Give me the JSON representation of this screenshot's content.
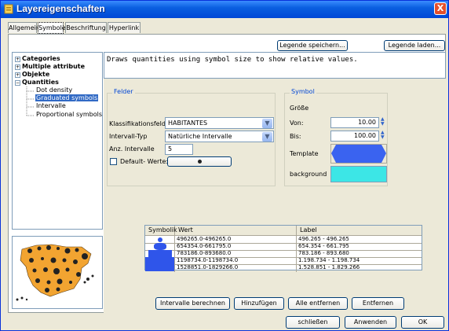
{
  "window": {
    "title": "Layereigenschaften",
    "close_glyph": "X"
  },
  "tabs": [
    {
      "label": "Allgemein"
    },
    {
      "label": "Symbole"
    },
    {
      "label": "Beschriftung"
    },
    {
      "label": "Hyperlink"
    }
  ],
  "legend_buttons": {
    "save": "Legende speichern...",
    "load": "Legende laden..."
  },
  "tree": {
    "items": [
      {
        "label": "Categories",
        "toggle": "+"
      },
      {
        "label": "Multiple attribute",
        "toggle": "+"
      },
      {
        "label": "Objekte",
        "toggle": "+"
      },
      {
        "label": "Quantities",
        "toggle": "−"
      }
    ],
    "children": [
      {
        "label": "Dot density"
      },
      {
        "label": "Graduated symbols"
      },
      {
        "label": "Intervalle"
      },
      {
        "label": "Proportional symbols"
      }
    ]
  },
  "description": "Draws quantities using symbol size to show relative values.",
  "felder": {
    "legend": "Felder",
    "classification_label": "Klassifikationsfeld",
    "classification_value": "HABITANTES",
    "interval_type_label": "Intervall-Typ",
    "interval_type_value": "Natürliche Intervalle",
    "interval_count_label": "Anz. Intervalle",
    "interval_count_value": "5",
    "default_values_label": "Default- Werte:"
  },
  "symbol": {
    "legend": "Symbol",
    "size_label": "Größe",
    "from_label": "Von:",
    "from_value": "10.00",
    "to_label": "Bis:",
    "to_value": "100.00",
    "template_label": "Template",
    "background_label": "background",
    "template_color": "#3a63f0",
    "background_color": "#3ce6e6"
  },
  "table": {
    "headers": [
      "Symbolik",
      "Wert",
      "Label"
    ],
    "rows": [
      {
        "wert": "496265.0-496265.0",
        "label": "496.265 - 496.265"
      },
      {
        "wert": "654354.0-661795.0",
        "label": "654.354 - 661.795"
      },
      {
        "wert": "783186.0-893680.0",
        "label": "783.186 - 893.680"
      },
      {
        "wert": "1198734.0-1198734.0",
        "label": "1.198.734 - 1.198.734"
      },
      {
        "wert": "1528851.0-1829266.0",
        "label": "1.528.851 - 1.829.266"
      }
    ]
  },
  "interval_buttons": {
    "calculate": "Intervalle berechnen",
    "add": "Hinzufügen",
    "remove_all": "Alle entfernen",
    "remove": "Entfernen"
  },
  "dialog_buttons": {
    "close": "schließen",
    "apply": "Anwenden",
    "ok": "OK"
  }
}
